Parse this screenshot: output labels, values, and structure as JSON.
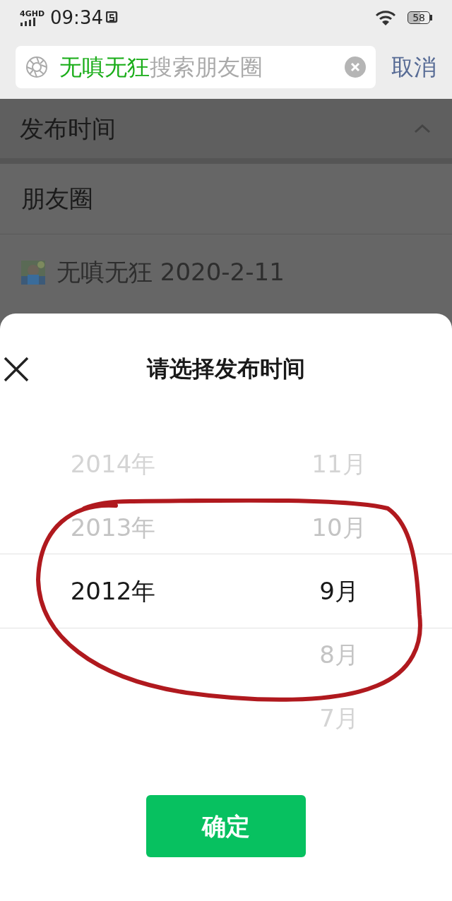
{
  "status_bar": {
    "network": "4GHD",
    "time": "09:34",
    "battery": "58"
  },
  "search": {
    "query": "无嗔无狂",
    "placeholder": "搜索朋友圈",
    "cancel": "取消"
  },
  "filter": {
    "title": "发布时间",
    "expanded": true
  },
  "section": {
    "title": "朋友圈"
  },
  "results": [
    {
      "author": "无嗔无狂",
      "date": "2020-2-11"
    }
  ],
  "sheet": {
    "title": "请选择发布时间",
    "confirm": "确定",
    "columns": [
      {
        "items": [
          {
            "label": "2014年",
            "selected": false
          },
          {
            "label": "2013年",
            "selected": false
          },
          {
            "label": "2012年",
            "selected": true
          }
        ]
      },
      {
        "items": [
          {
            "label": "11月",
            "selected": false
          },
          {
            "label": "10月",
            "selected": false
          },
          {
            "label": "9月",
            "selected": true
          },
          {
            "label": "8月",
            "selected": false
          },
          {
            "label": "7月",
            "selected": false
          }
        ]
      }
    ]
  },
  "annotation": {
    "kind": "loop"
  }
}
